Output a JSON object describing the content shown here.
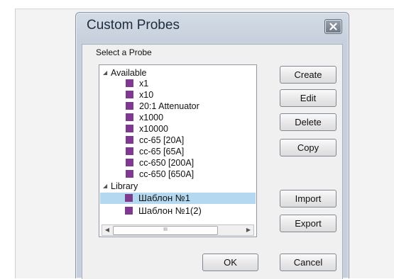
{
  "dialog": {
    "title": "Custom Probes",
    "group_label": "Select a Probe"
  },
  "tree": {
    "available": {
      "label": "Available",
      "items": [
        "x1",
        "x10",
        "20:1 Attenuator",
        "x1000",
        "x10000",
        "cc-65 [20A]",
        "cc-65 [65A]",
        "cc-650 [200A]",
        "cc-650 [650A]"
      ]
    },
    "library": {
      "label": "Library",
      "items": [
        "Шаблон №1",
        "Шаблон №1(2)"
      ],
      "selected": "Шаблон №1"
    },
    "scrollbar_grip": "III"
  },
  "buttons": {
    "create": "Create",
    "edit": "Edit",
    "delete": "Delete",
    "copy": "Copy",
    "import": "Import",
    "export": "Export",
    "ok": "OK",
    "cancel": "Cancel"
  },
  "colors": {
    "probe_marker": "#7d3a8f",
    "selection": "#b3d8ef"
  },
  "icons": {
    "close": "close-icon",
    "expander": "expanded-triangle-icon"
  }
}
